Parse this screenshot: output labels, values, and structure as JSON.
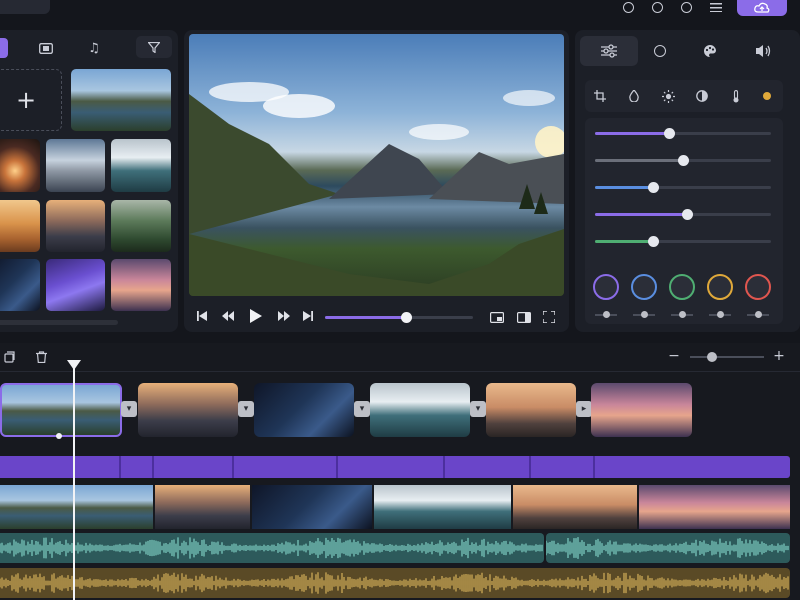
{
  "app": {
    "accent": "#8b6ce8",
    "top_icons": [
      "circle-icon",
      "circle-icon",
      "add-circle-icon",
      "list-settings-icon"
    ],
    "export_icon": "cloud-upload-icon"
  },
  "media_bin": {
    "tabs": [
      "video-tab-icon",
      "film-icon",
      "music-icon"
    ],
    "filter_icon": "filter-icon",
    "add_label": "+",
    "thumbnails": [
      "lake-mountains",
      "sunset",
      "snowy-peaks",
      "ocean-waves",
      "desert-dunes",
      "city-skyline",
      "misty-forest",
      "neon-portrait",
      "purple-abstract",
      "pink-clouds"
    ]
  },
  "preview": {
    "controls": [
      "skip-back-icon",
      "rewind-icon",
      "play-icon",
      "fast-forward-icon",
      "skip-forward-icon"
    ],
    "progress": 0.55,
    "view_icons": [
      "pip-icon",
      "split-view-icon",
      "fullscreen-icon"
    ]
  },
  "inspector": {
    "tabs": [
      "sliders-icon",
      "circle-icon",
      "palette-icon",
      "speaker-icon"
    ],
    "tools": [
      "crop-icon",
      "drop-icon",
      "sun-icon",
      "contrast-icon",
      "thermometer-icon",
      "dot-icon"
    ],
    "sliders": [
      {
        "name": "slider-1",
        "value": 0.42,
        "color": "#8b6ce8"
      },
      {
        "name": "slider-2",
        "value": 0.5,
        "color": "#6b6f7a"
      },
      {
        "name": "slider-3",
        "value": 0.33,
        "color": "#5a8ee0"
      },
      {
        "name": "slider-4",
        "value": 0.52,
        "color": "#8b6ce8"
      },
      {
        "name": "slider-5",
        "value": 0.33,
        "color": "#4fae72"
      }
    ],
    "wheels": [
      {
        "color": "#8b6ce8"
      },
      {
        "color": "#5a8ee0"
      },
      {
        "color": "#4fae72"
      },
      {
        "color": "#e0a93a"
      },
      {
        "color": "#e0564f"
      }
    ]
  },
  "timeline": {
    "tool_icons": [
      "copy-icon",
      "trash-icon"
    ],
    "zoom_minus": "−",
    "zoom_plus": "+",
    "zoom_level": 0.3
  }
}
